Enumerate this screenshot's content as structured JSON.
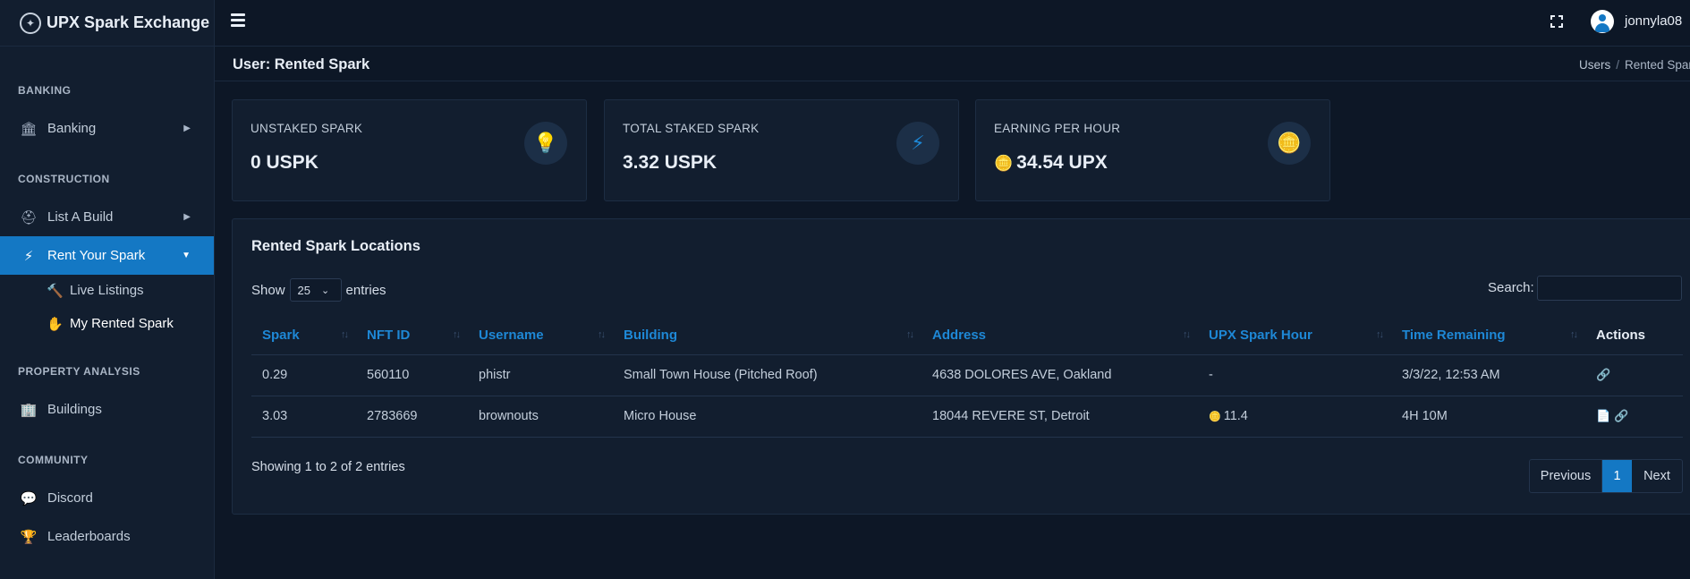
{
  "brand": {
    "title": "UPX Spark Exchange"
  },
  "sidebar": {
    "sections": {
      "banking": "BANKING",
      "construction": "CONSTRUCTION",
      "property": "PROPERTY ANALYSIS",
      "community": "COMMUNITY"
    },
    "items": {
      "banking": "Banking",
      "list_build": "List A Build",
      "rent_spark": "Rent Your Spark",
      "live_listings": "Live Listings",
      "my_rented": "My Rented Spark",
      "buildings": "Buildings",
      "discord": "Discord",
      "leaderboards": "Leaderboards"
    }
  },
  "topbar": {
    "username": "jonnyla08"
  },
  "header": {
    "title": "User: Rented Spark",
    "breadcrumb": [
      "Users",
      "Rented Spark"
    ]
  },
  "cards": [
    {
      "label": "UNSTAKED SPARK",
      "value": "0 USPK",
      "icon": "lightbulb-icon"
    },
    {
      "label": "TOTAL STAKED SPARK",
      "value": "3.32 USPK",
      "icon": "bolt-icon"
    },
    {
      "label": "EARNING PER HOUR",
      "value": "34.54 UPX",
      "icon": "coins-icon"
    }
  ],
  "table": {
    "title": "Rented Spark Locations",
    "show_label": "Show",
    "entries_label": "entries",
    "page_size": "25",
    "search_label": "Search:",
    "search_value": "",
    "columns": [
      "Spark",
      "NFT ID",
      "Username",
      "Building",
      "Address",
      "UPX Spark Hour",
      "Time Remaining",
      "Actions"
    ],
    "rows": [
      {
        "spark": "0.29",
        "nft_id": "560110",
        "username": "phistr",
        "building": "Small Town House (Pitched Roof)",
        "address": "4638 DOLORES AVE, Oakland",
        "upx_hour": "-",
        "time_remaining": "3/3/22, 12:53 AM"
      },
      {
        "spark": "3.03",
        "nft_id": "2783669",
        "username": "brownouts",
        "building": "Micro House",
        "address": "18044 REVERE ST, Detroit",
        "upx_hour": "11.4",
        "time_remaining": "4H 10M"
      }
    ],
    "showing": "Showing 1 to 2 of 2 entries",
    "pager": {
      "prev": "Previous",
      "page": "1",
      "next": "Next"
    }
  },
  "colors": {
    "accent": "#1478c4",
    "link": "#1e88d6",
    "bg": "#0d1726",
    "panel": "#121e2f"
  }
}
